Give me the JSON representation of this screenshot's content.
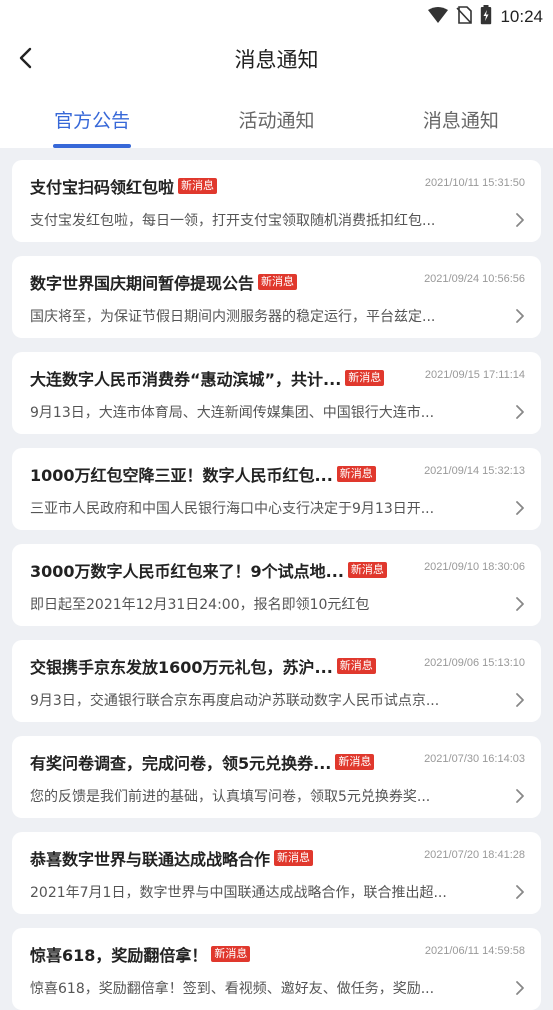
{
  "status_bar": {
    "time": "10:24"
  },
  "header": {
    "title": "消息通知"
  },
  "tabs": [
    {
      "label": "官方公告",
      "active": true
    },
    {
      "label": "活动通知",
      "active": false
    },
    {
      "label": "消息通知",
      "active": false
    }
  ],
  "badge_label": "新消息",
  "colors": {
    "accent": "#3768d8",
    "badge": "#e0382d"
  },
  "notices": [
    {
      "title": "支付宝扫码领红包啦",
      "date": "2021/10/11 15:31:50",
      "summary": "支付宝发红包啦，每日一领，打开支付宝领取随机消费抵扣红包..."
    },
    {
      "title": "数字世界国庆期间暂停提现公告",
      "date": "2021/09/24 10:56:56",
      "summary": "国庆将至，为保证节假日期间内测服务器的稳定运行，平台兹定..."
    },
    {
      "title": "大连数字人民币消费券“惠动滨城”，共计...",
      "date": "2021/09/15 17:11:14",
      "summary": "9月13日，大连市体育局、大连新闻传媒集团、中国银行大连市..."
    },
    {
      "title": "1000万红包空降三亚！数字人民币红包...",
      "date": "2021/09/14 15:32:13",
      "summary": "三亚市人民政府和中国人民银行海口中心支行决定于9月13日开..."
    },
    {
      "title": "3000万数字人民币红包来了！9个试点地...",
      "date": "2021/09/10 18:30:06",
      "summary": "即日起至2021年12月31日24:00，报名即领10元红包"
    },
    {
      "title": "交银携手京东发放1600万元礼包，苏沪...",
      "date": "2021/09/06 15:13:10",
      "summary": "9月3日，交通银行联合京东再度启动沪苏联动数字人民币试点京..."
    },
    {
      "title": "有奖问卷调查，完成问卷，领5元兑换券...",
      "date": "2021/07/30 16:14:03",
      "summary": "您的反馈是我们前进的基础，认真填写问卷，领取5元兑换券奖..."
    },
    {
      "title": "恭喜数字世界与联通达成战略合作",
      "date": "2021/07/20 18:41:28",
      "summary": "2021年7月1日，数字世界与中国联通达成战略合作，联合推出超..."
    },
    {
      "title": "惊喜618，奖励翻倍拿！",
      "date": "2021/06/11 14:59:58",
      "summary": "惊喜618，奖励翻倍拿！签到、看视频、邀好友、做任务，奖励..."
    }
  ]
}
